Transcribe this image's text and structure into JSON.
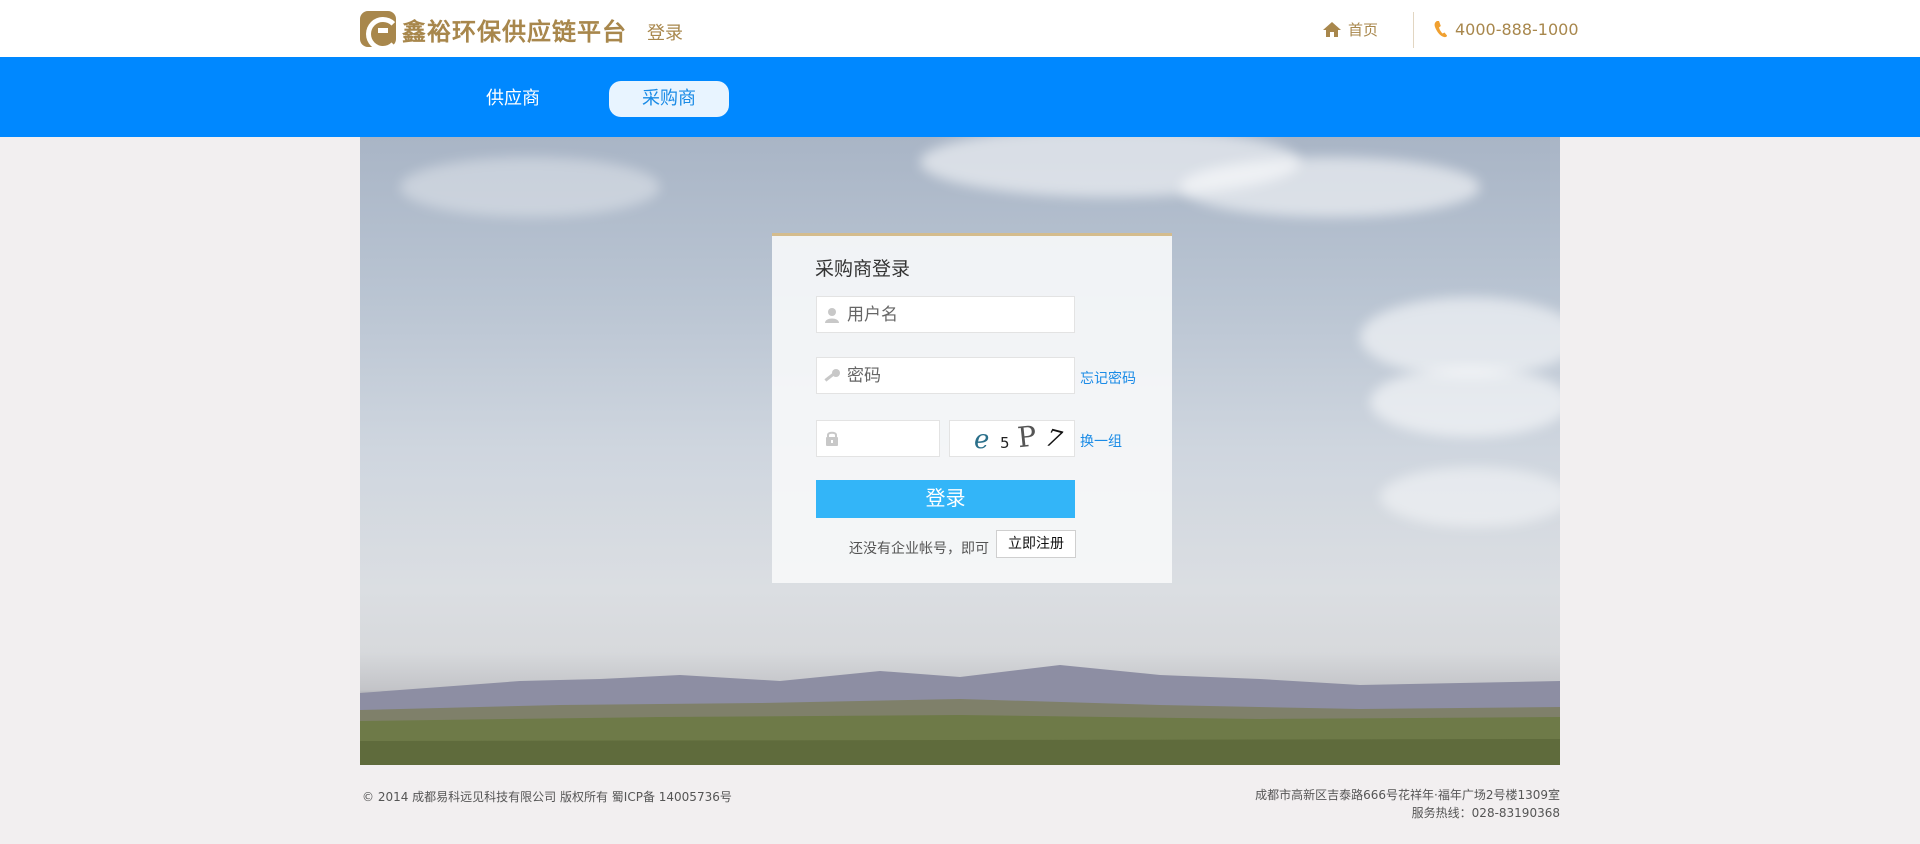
{
  "header": {
    "brand": "鑫裕环保供应链平台",
    "page_label": "登录",
    "home_label": "首页",
    "phone": "4000-888-1000"
  },
  "nav": {
    "tabs": [
      {
        "label": "供应商",
        "active": false
      },
      {
        "label": "采购商",
        "active": true
      }
    ]
  },
  "login": {
    "title": "采购商登录",
    "username_placeholder": "用户名",
    "password_placeholder": "密码",
    "code_placeholder": "",
    "forgot_label": "忘记密码",
    "captcha_chars": [
      "e",
      "5",
      "P",
      "7"
    ],
    "swap_label": "换一组",
    "submit_label": "登录",
    "no_account_text": "还没有企业帐号，即可",
    "register_label": "立即注册"
  },
  "footer": {
    "copyright": "© 2014 成都易科远见科技有限公司 版权所有 蜀ICP备 14005736号",
    "address": "成都市高新区吉泰路666号花祥年·福年广场2号楼1309室",
    "hotline": "服务热线：028-83190368"
  },
  "colors": {
    "brand_gold": "#a8874c",
    "nav_blue": "#0088ff",
    "button_blue": "#33b5f8",
    "link_blue": "#1a8be6"
  }
}
